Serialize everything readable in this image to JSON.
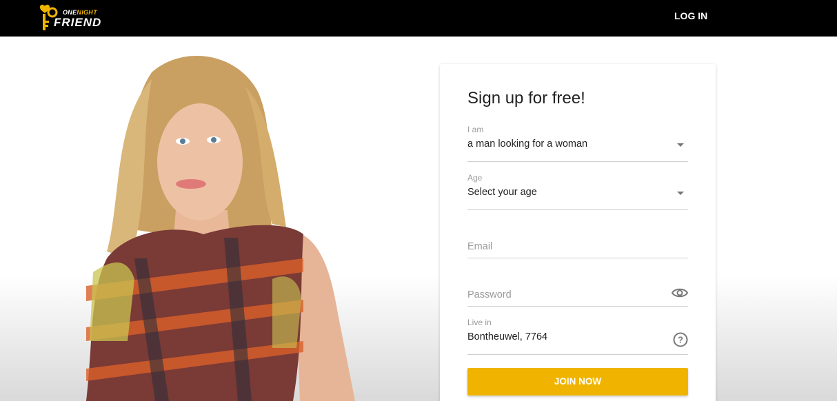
{
  "header": {
    "logo_top_prefix": "ONE",
    "logo_top_accent": "NIGHT",
    "logo_bottom": "FRIEND",
    "login_label": "LOG IN"
  },
  "form": {
    "title": "Sign up for free!",
    "i_am": {
      "label": "I am",
      "value": "a man looking for a woman"
    },
    "age": {
      "label": "Age",
      "value": "Select your age"
    },
    "email": {
      "placeholder": "Email"
    },
    "password": {
      "placeholder": "Password"
    },
    "live_in": {
      "label": "Live in",
      "value": "Bontheuwel, 7764"
    },
    "join_label": "JOIN NOW"
  },
  "colors": {
    "accent": "#f0b400",
    "header_bg": "#000000"
  },
  "icons": {
    "logo": "key-heart-icon",
    "password_toggle": "eye-icon",
    "location_help": "help-circle-icon",
    "dropdown": "caret-down-icon"
  }
}
